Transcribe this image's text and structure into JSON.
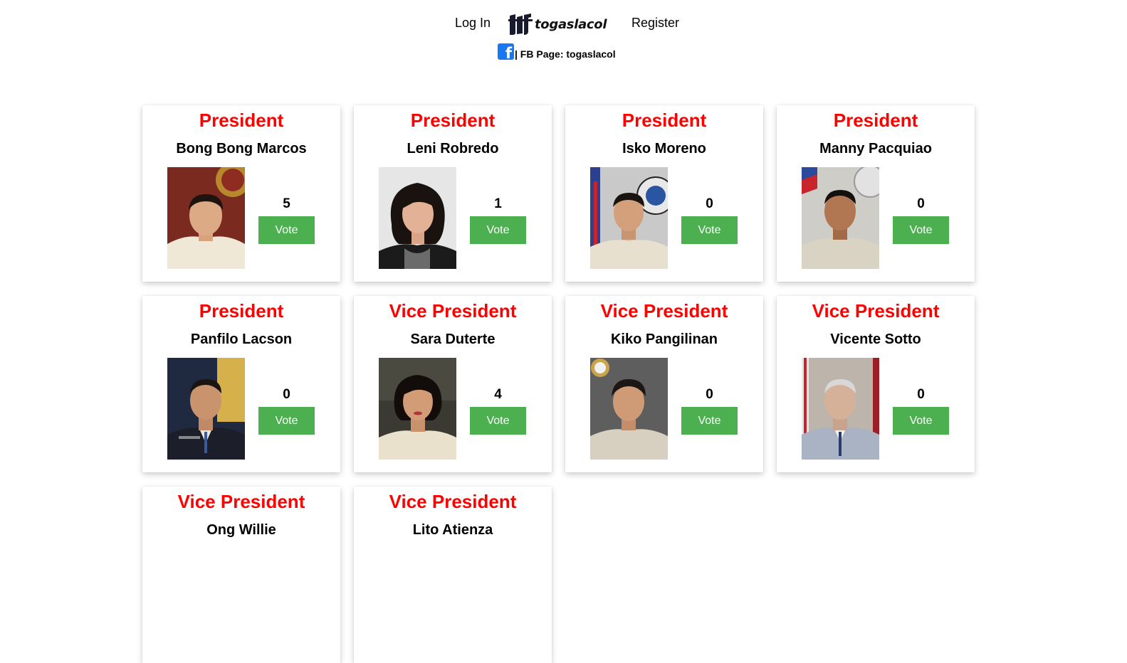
{
  "nav": {
    "login_label": "Log In",
    "brand_text": "togaslacol",
    "register_label": "Register"
  },
  "fb": {
    "icon": "facebook-icon",
    "label": "| FB Page: togaslacol"
  },
  "colors": {
    "position_red": "#ff0000",
    "vote_green": "#4caf50",
    "facebook_blue": "#1877f2"
  },
  "candidates": [
    {
      "position": "President",
      "name": "Bong Bong Marcos",
      "votes": "5",
      "vote_label": "Vote"
    },
    {
      "position": "President",
      "name": "Leni Robredo",
      "votes": "1",
      "vote_label": "Vote"
    },
    {
      "position": "President",
      "name": "Isko Moreno",
      "votes": "0",
      "vote_label": "Vote"
    },
    {
      "position": "President",
      "name": "Manny Pacquiao",
      "votes": "0",
      "vote_label": "Vote"
    },
    {
      "position": "President",
      "name": "Panfilo Lacson",
      "votes": "0",
      "vote_label": "Vote"
    },
    {
      "position": "Vice President",
      "name": "Sara Duterte",
      "votes": "4",
      "vote_label": "Vote"
    },
    {
      "position": "Vice President",
      "name": "Kiko Pangilinan",
      "votes": "0",
      "vote_label": "Vote"
    },
    {
      "position": "Vice President",
      "name": "Vicente Sotto",
      "votes": "0",
      "vote_label": "Vote"
    },
    {
      "position": "Vice President",
      "name": "Ong Willie",
      "votes": "",
      "vote_label": ""
    },
    {
      "position": "Vice President",
      "name": "Lito Atienza",
      "votes": "",
      "vote_label": ""
    }
  ]
}
